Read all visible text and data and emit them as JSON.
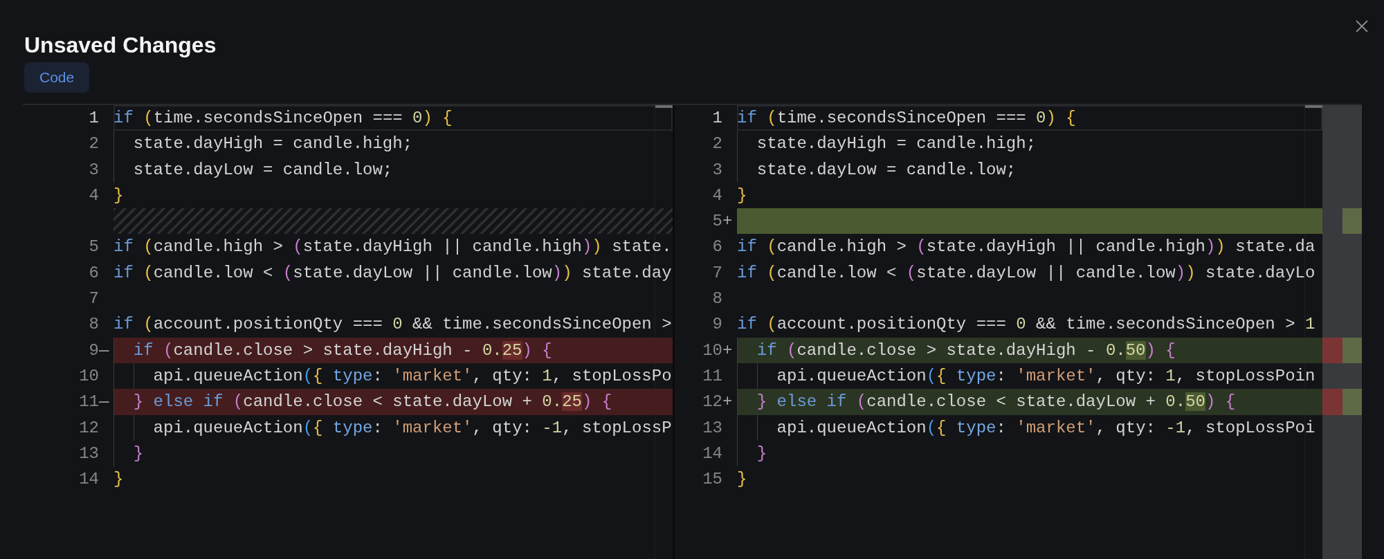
{
  "dialog": {
    "title": "Unsaved Changes"
  },
  "tabs": [
    {
      "label": "Code",
      "selected": true
    }
  ],
  "diff": {
    "panes": [
      {
        "lines": [
          {
            "kind": "unchanged",
            "number": "1",
            "current": true,
            "tokens": [
              {
                "kind": "keyword",
                "text": "if"
              },
              {
                "kind": "paren1",
                "text": " ("
              },
              {
                "kind": "plain",
                "text": "time.secondsSinceOpen === "
              },
              {
                "kind": "number",
                "text": "0"
              },
              {
                "kind": "paren1",
                "text": ")"
              },
              {
                "kind": "paren1",
                "text": " {"
              }
            ]
          },
          {
            "kind": "unchanged",
            "number": "2",
            "current": false,
            "tokens": [
              {
                "kind": "plain",
                "text": "  state.dayHigh = candle.high;"
              }
            ]
          },
          {
            "kind": "unchanged",
            "number": "3",
            "current": false,
            "tokens": [
              {
                "kind": "plain",
                "text": "  state.dayLow = candle.low;"
              }
            ]
          },
          {
            "kind": "unchanged",
            "number": "4",
            "current": false,
            "tokens": [
              {
                "kind": "paren1",
                "text": "}"
              }
            ]
          },
          {
            "kind": "spacer"
          },
          {
            "kind": "unchanged",
            "number": "5",
            "current": false,
            "tokens": [
              {
                "kind": "keyword",
                "text": "if"
              },
              {
                "kind": "paren1",
                "text": " ("
              },
              {
                "kind": "plain",
                "text": "candle.high > "
              },
              {
                "kind": "paren2",
                "text": "("
              },
              {
                "kind": "plain",
                "text": "state.dayHigh || candle.high"
              },
              {
                "kind": "paren2",
                "text": ")"
              },
              {
                "kind": "paren1",
                "text": ")"
              },
              {
                "kind": "plain",
                "text": " state."
              }
            ]
          },
          {
            "kind": "unchanged",
            "number": "6",
            "current": false,
            "tokens": [
              {
                "kind": "keyword",
                "text": "if"
              },
              {
                "kind": "paren1",
                "text": " ("
              },
              {
                "kind": "plain",
                "text": "candle.low < "
              },
              {
                "kind": "paren2",
                "text": "("
              },
              {
                "kind": "plain",
                "text": "state.dayLow || candle.low"
              },
              {
                "kind": "paren2",
                "text": ")"
              },
              {
                "kind": "paren1",
                "text": ")"
              },
              {
                "kind": "plain",
                "text": " state.day"
              }
            ]
          },
          {
            "kind": "unchanged",
            "number": "7",
            "current": false
          },
          {
            "kind": "unchanged",
            "number": "8",
            "current": false,
            "tokens": [
              {
                "kind": "keyword",
                "text": "if"
              },
              {
                "kind": "paren1",
                "text": " ("
              },
              {
                "kind": "plain",
                "text": "account.positionQty === "
              },
              {
                "kind": "number",
                "text": "0"
              },
              {
                "kind": "plain",
                "text": " && time.secondsSinceOpen >"
              }
            ]
          },
          {
            "kind": "removed",
            "number": "9",
            "sign": "—",
            "current": false,
            "tokens": [
              {
                "kind": "keyword",
                "text": "  if"
              },
              {
                "kind": "paren2",
                "text": " ("
              },
              {
                "kind": "plain",
                "text": "candle.close > state.dayHigh - "
              },
              {
                "kind": "number",
                "text": "0."
              },
              {
                "kind": "changed",
                "text": "25"
              },
              {
                "kind": "paren2",
                "text": ")"
              },
              {
                "kind": "paren2",
                "text": " {"
              }
            ]
          },
          {
            "kind": "unchanged",
            "number": "10",
            "current": false,
            "tokens": [
              {
                "kind": "plain",
                "text": "    api.queueAction"
              },
              {
                "kind": "paren3",
                "text": "("
              },
              {
                "kind": "paren1",
                "text": "{"
              },
              {
                "kind": "property",
                "text": " type"
              },
              {
                "kind": "plain",
                "text": ": "
              },
              {
                "kind": "string",
                "text": "'market'"
              },
              {
                "kind": "plain",
                "text": ", qty: "
              },
              {
                "kind": "number",
                "text": "1"
              },
              {
                "kind": "plain",
                "text": ", stopLossPo"
              }
            ]
          },
          {
            "kind": "removed",
            "number": "11",
            "sign": "—",
            "current": false,
            "tokens": [
              {
                "kind": "paren2",
                "text": "  }"
              },
              {
                "kind": "keyword",
                "text": " else"
              },
              {
                "kind": "keyword",
                "text": " if"
              },
              {
                "kind": "paren2",
                "text": " ("
              },
              {
                "kind": "plain",
                "text": "candle.close < state.dayLow + "
              },
              {
                "kind": "number",
                "text": "0."
              },
              {
                "kind": "changed",
                "text": "25"
              },
              {
                "kind": "paren2",
                "text": ")"
              },
              {
                "kind": "paren2",
                "text": " {"
              }
            ]
          },
          {
            "kind": "unchanged",
            "number": "12",
            "current": false,
            "tokens": [
              {
                "kind": "plain",
                "text": "    api.queueAction"
              },
              {
                "kind": "paren3",
                "text": "("
              },
              {
                "kind": "paren1",
                "text": "{"
              },
              {
                "kind": "property",
                "text": " type"
              },
              {
                "kind": "plain",
                "text": ": "
              },
              {
                "kind": "string",
                "text": "'market'"
              },
              {
                "kind": "plain",
                "text": ", qty: "
              },
              {
                "kind": "number",
                "text": "-1"
              },
              {
                "kind": "plain",
                "text": ", stopLossP"
              }
            ]
          },
          {
            "kind": "unchanged",
            "number": "13",
            "current": false,
            "tokens": [
              {
                "kind": "paren2",
                "text": "  }"
              }
            ]
          },
          {
            "kind": "unchanged",
            "number": "14",
            "current": false,
            "tokens": [
              {
                "kind": "paren1",
                "text": "}"
              }
            ]
          }
        ]
      },
      {
        "lines": [
          {
            "kind": "unchanged",
            "number": "1",
            "current": true,
            "tokens": [
              {
                "kind": "keyword",
                "text": "if"
              },
              {
                "kind": "paren1",
                "text": " ("
              },
              {
                "kind": "plain",
                "text": "time.secondsSinceOpen === "
              },
              {
                "kind": "number",
                "text": "0"
              },
              {
                "kind": "paren1",
                "text": ")"
              },
              {
                "kind": "paren1",
                "text": " {"
              }
            ]
          },
          {
            "kind": "unchanged",
            "number": "2",
            "current": false,
            "tokens": [
              {
                "kind": "plain",
                "text": "  state.dayHigh = candle.high;"
              }
            ]
          },
          {
            "kind": "unchanged",
            "number": "3",
            "current": false,
            "tokens": [
              {
                "kind": "plain",
                "text": "  state.dayLow = candle.low;"
              }
            ]
          },
          {
            "kind": "unchanged",
            "number": "4",
            "current": false,
            "tokens": [
              {
                "kind": "paren1",
                "text": "}"
              }
            ]
          },
          {
            "kind": "inserted",
            "number": "5",
            "sign": "+",
            "current": false
          },
          {
            "kind": "unchanged",
            "number": "6",
            "current": false,
            "tokens": [
              {
                "kind": "keyword",
                "text": "if"
              },
              {
                "kind": "paren1",
                "text": " ("
              },
              {
                "kind": "plain",
                "text": "candle.high > "
              },
              {
                "kind": "paren2",
                "text": "("
              },
              {
                "kind": "plain",
                "text": "state.dayHigh || candle.high"
              },
              {
                "kind": "paren2",
                "text": ")"
              },
              {
                "kind": "paren1",
                "text": ")"
              },
              {
                "kind": "plain",
                "text": " state.da"
              }
            ]
          },
          {
            "kind": "unchanged",
            "number": "7",
            "current": false,
            "tokens": [
              {
                "kind": "keyword",
                "text": "if"
              },
              {
                "kind": "paren1",
                "text": " ("
              },
              {
                "kind": "plain",
                "text": "candle.low < "
              },
              {
                "kind": "paren2",
                "text": "("
              },
              {
                "kind": "plain",
                "text": "state.dayLow || candle.low"
              },
              {
                "kind": "paren2",
                "text": ")"
              },
              {
                "kind": "paren1",
                "text": ")"
              },
              {
                "kind": "plain",
                "text": " state.dayLo"
              }
            ]
          },
          {
            "kind": "unchanged",
            "number": "8",
            "current": false
          },
          {
            "kind": "unchanged",
            "number": "9",
            "current": false,
            "tokens": [
              {
                "kind": "keyword",
                "text": "if"
              },
              {
                "kind": "paren1",
                "text": " ("
              },
              {
                "kind": "plain",
                "text": "account.positionQty === "
              },
              {
                "kind": "number",
                "text": "0"
              },
              {
                "kind": "plain",
                "text": " && time.secondsSinceOpen > "
              },
              {
                "kind": "number",
                "text": "1"
              }
            ]
          },
          {
            "kind": "added",
            "number": "10",
            "sign": "+",
            "current": false,
            "tokens": [
              {
                "kind": "keyword",
                "text": "  if"
              },
              {
                "kind": "paren2",
                "text": " ("
              },
              {
                "kind": "plain",
                "text": "candle.close > state.dayHigh - "
              },
              {
                "kind": "number",
                "text": "0."
              },
              {
                "kind": "changed",
                "text": "50"
              },
              {
                "kind": "paren2",
                "text": ")"
              },
              {
                "kind": "paren2",
                "text": " {"
              }
            ]
          },
          {
            "kind": "unchanged",
            "number": "11",
            "current": false,
            "tokens": [
              {
                "kind": "plain",
                "text": "    api.queueAction"
              },
              {
                "kind": "paren3",
                "text": "("
              },
              {
                "kind": "paren1",
                "text": "{"
              },
              {
                "kind": "property",
                "text": " type"
              },
              {
                "kind": "plain",
                "text": ": "
              },
              {
                "kind": "string",
                "text": "'market'"
              },
              {
                "kind": "plain",
                "text": ", qty: "
              },
              {
                "kind": "number",
                "text": "1"
              },
              {
                "kind": "plain",
                "text": ", stopLossPoin"
              }
            ]
          },
          {
            "kind": "added",
            "number": "12",
            "sign": "+",
            "current": false,
            "tokens": [
              {
                "kind": "paren2",
                "text": "  }"
              },
              {
                "kind": "keyword",
                "text": " else"
              },
              {
                "kind": "keyword",
                "text": " if"
              },
              {
                "kind": "paren2",
                "text": " ("
              },
              {
                "kind": "plain",
                "text": "candle.close < state.dayLow + "
              },
              {
                "kind": "number",
                "text": "0."
              },
              {
                "kind": "changed",
                "text": "50"
              },
              {
                "kind": "paren2",
                "text": ")"
              },
              {
                "kind": "paren2",
                "text": " {"
              }
            ]
          },
          {
            "kind": "unchanged",
            "number": "13",
            "current": false,
            "tokens": [
              {
                "kind": "plain",
                "text": "    api.queueAction"
              },
              {
                "kind": "paren3",
                "text": "("
              },
              {
                "kind": "paren1",
                "text": "{"
              },
              {
                "kind": "property",
                "text": " type"
              },
              {
                "kind": "plain",
                "text": ": "
              },
              {
                "kind": "string",
                "text": "'market'"
              },
              {
                "kind": "plain",
                "text": ", qty: "
              },
              {
                "kind": "number",
                "text": "-1"
              },
              {
                "kind": "plain",
                "text": ", stopLossPoi"
              }
            ]
          },
          {
            "kind": "unchanged",
            "number": "14",
            "current": false,
            "tokens": [
              {
                "kind": "paren2",
                "text": "  }"
              }
            ]
          },
          {
            "kind": "unchanged",
            "number": "15",
            "current": false,
            "tokens": [
              {
                "kind": "paren1",
                "text": "}"
              }
            ]
          }
        ]
      }
    ]
  }
}
